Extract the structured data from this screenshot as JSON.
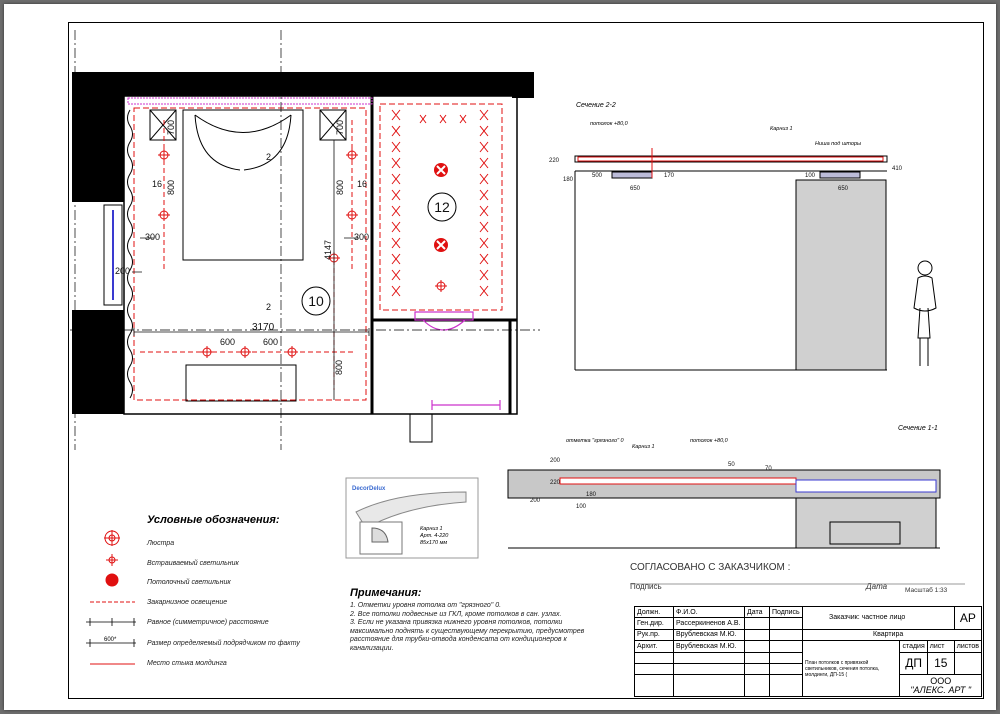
{
  "plan": {
    "room_10": "10",
    "room_12": "12",
    "dim_700_left": "700",
    "dim_700_right": "700",
    "dim_800_left": "800",
    "dim_800_right": "800",
    "dim_16_left": "16",
    "dim_16_right": "16",
    "dim_300_left": "300",
    "dim_300_right": "300",
    "dim_200": "200",
    "dim_4147": "4147",
    "dim_3170": "3170",
    "dim_600_a": "600",
    "dim_600_b": "600",
    "dim_800_bottom": "800",
    "section_mark_2_top": "2",
    "section_mark_2_mid": "2"
  },
  "section_2": {
    "title": "Сечение 2-2",
    "dims": [
      "220",
      "180",
      "500",
      "650",
      "170",
      "100",
      "650",
      "410"
    ],
    "label_ceiling": "потолок +80,0",
    "label_cornice": "Карниз 1",
    "label_niche": "Ниша под шторы"
  },
  "section_1": {
    "title": "Сечение 1-1",
    "dims": [
      "200",
      "220",
      "200",
      "180",
      "100",
      "50",
      "70"
    ],
    "label_dirty": "отметка \"грязного\" 0",
    "label_cornice": "Карниз 1",
    "label_ceiling": "потолок +80,0"
  },
  "molding": {
    "brand": "DecorDelux",
    "caption_lines": [
      "Карниз 1",
      "Арт. 4-220",
      "85x170 мм"
    ]
  },
  "legend": {
    "title": "Условные обозначения:",
    "items": [
      {
        "icon": "chandelier-icon",
        "label": "Люстра"
      },
      {
        "icon": "recessed-light-icon",
        "label": "Встраиваемый светильник"
      },
      {
        "icon": "ceiling-light-icon",
        "label": "Потолочный светильник"
      },
      {
        "icon": "hidden-lighting-line-icon",
        "label": "Закарнизное освещение"
      },
      {
        "icon": "equal-spacing-icon",
        "label": "Равное (симметричное) расстояние"
      },
      {
        "icon": "contractor-dimension-icon",
        "label": "Размер определяемый подрядчиком по факту",
        "symbol": "600*"
      },
      {
        "icon": "molding-joint-line-icon",
        "label": "Место стыка молдинга"
      }
    ]
  },
  "notes": {
    "title": "Примечания:",
    "lines": [
      "1.  Отметки уровня потолка от \"грязного\" 0.",
      "2. Все потолки подвесные из ГКЛ, кроме потолков в сан. узлах.",
      "3. Если не указана привязка нижнего уровня потолков, потолки максимально поднять к существующему перекрытию, предусмотрев расстояние для трубки-отвода конденсата от кондиционеров к канализации."
    ]
  },
  "approval": {
    "heading": "СОГЛАСОВАНО С ЗАКАЗЧИКОМ :",
    "signature": "Подпись",
    "date": "Дата",
    "scale": "Масштаб 1:33"
  },
  "title_block": {
    "header": [
      "Должн.",
      "Ф.И.О.",
      "Дата",
      "Подпись"
    ],
    "rows": [
      [
        "Ген.дир.",
        "Рассеркиненов А.В."
      ],
      [
        "Рук.пр.",
        "Врублевская М.Ю."
      ],
      [
        "Архит.",
        "Врублевская М.Ю."
      ]
    ],
    "client": "Заказчик:   частное лицо",
    "object": "Квартира",
    "sheet_title_lines": [
      "План потолков с привязкой",
      "светильников, сечения потолка,",
      "молдинги, ДП-15 ("
    ],
    "code": "АР",
    "stage_label": "стадия",
    "sheet_label": "лист",
    "sheets_label": "листов",
    "stage": "ДП",
    "sheet": "15",
    "company_line1": "ООО",
    "company_line2": "\"АЛЕКС. АРТ \""
  },
  "colors": {
    "wall": "#000000",
    "accent": "#e01010",
    "magenta": "#cc33cc",
    "dimension": "#1a1a1a",
    "blue": "#3a3ad0"
  }
}
